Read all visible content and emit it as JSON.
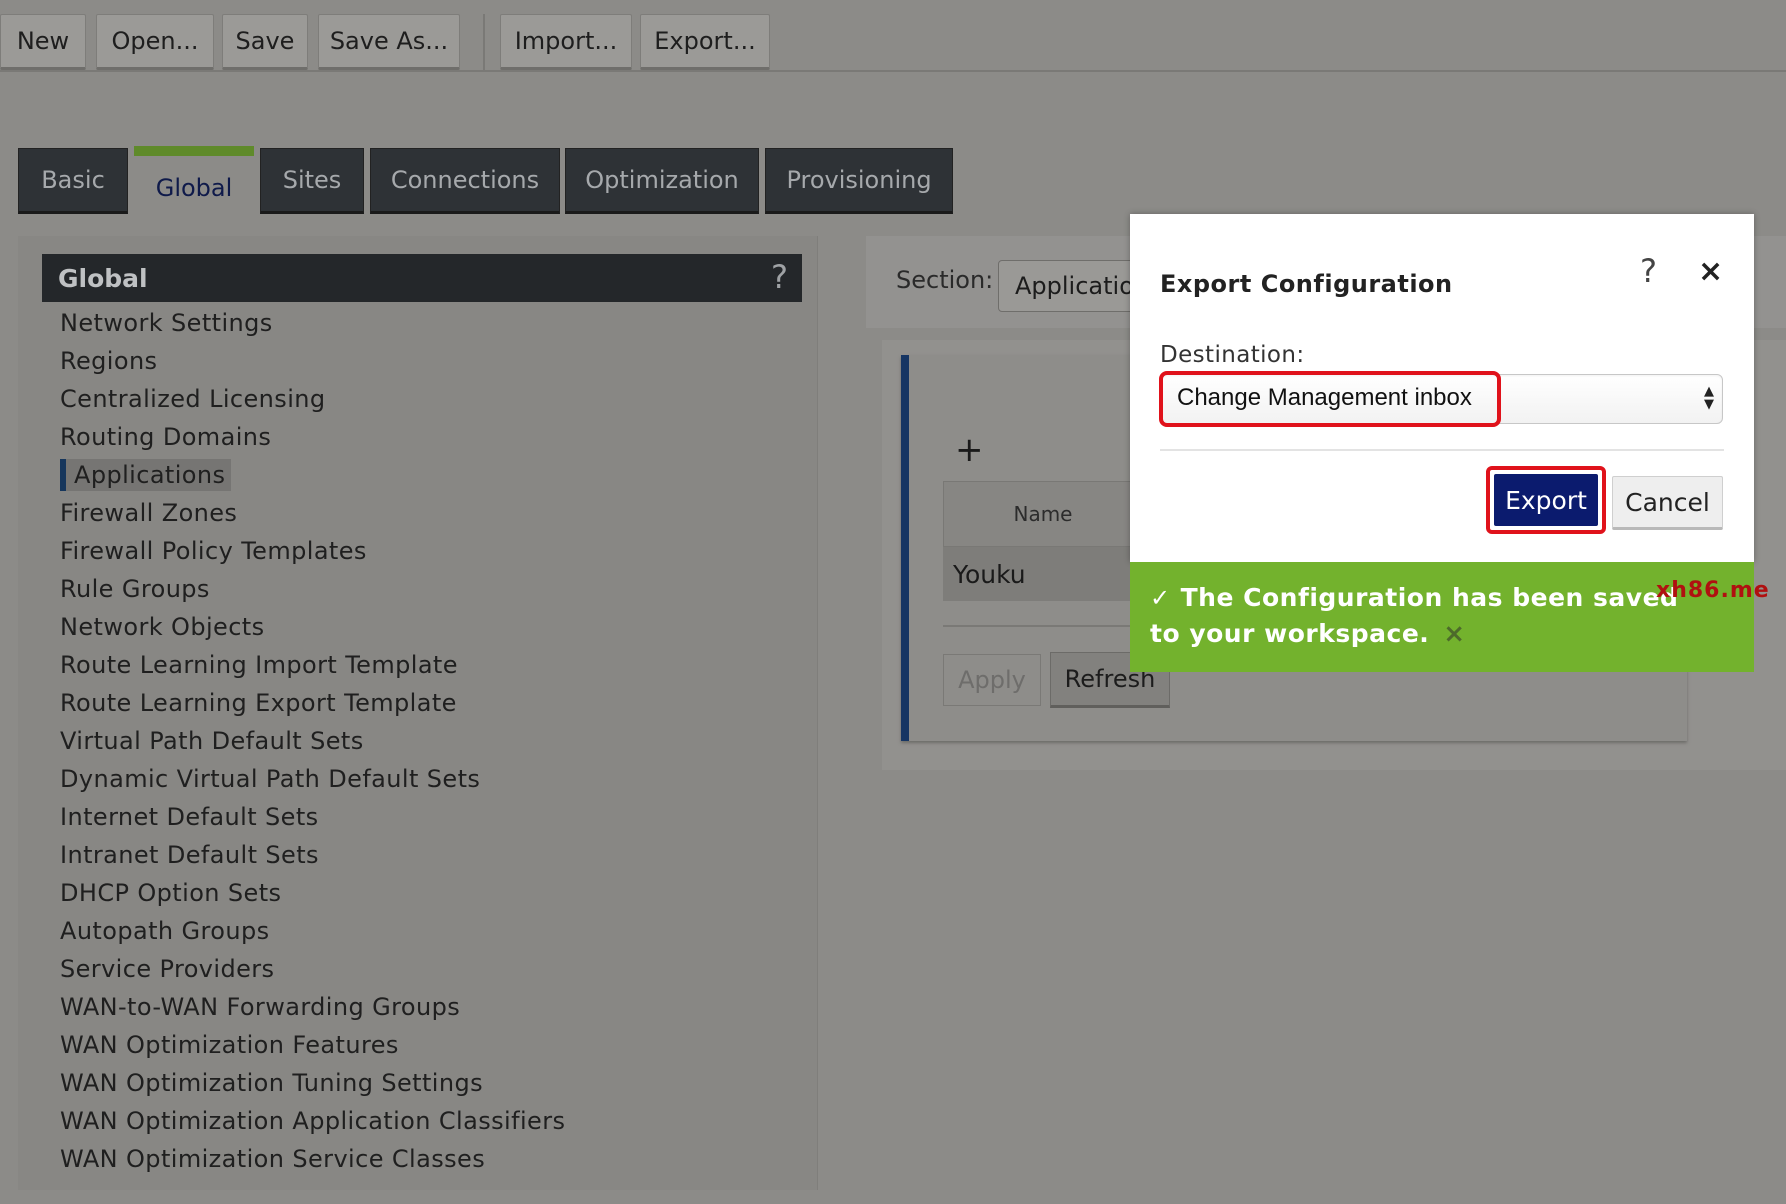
{
  "toolbar": {
    "buttons": [
      "New",
      "Open...",
      "Save",
      "Save As...",
      "Import...",
      "Export..."
    ]
  },
  "tabs": [
    {
      "label": "Basic",
      "active": false
    },
    {
      "label": "Global",
      "active": true
    },
    {
      "label": "Sites",
      "active": false
    },
    {
      "label": "Connections",
      "active": false
    },
    {
      "label": "Optimization",
      "active": false
    },
    {
      "label": "Provisioning",
      "active": false
    }
  ],
  "left_panel": {
    "title": "Global",
    "help": "?",
    "selected": "Applications",
    "items": [
      "Network Settings",
      "Regions",
      "Centralized Licensing",
      "Routing Domains",
      "Applications",
      "Firewall Zones",
      "Firewall Policy Templates",
      "Rule Groups",
      "Network Objects",
      "Route Learning Import Template",
      "Route Learning Export Template",
      "Virtual Path Default Sets",
      "Dynamic Virtual Path Default Sets",
      "Internet Default Sets",
      "Intranet Default Sets",
      "DHCP Option Sets",
      "Autopath Groups",
      "Service Providers",
      "WAN-to-WAN Forwarding Groups",
      "WAN Optimization Features",
      "WAN Optimization Tuning Settings",
      "WAN Optimization Application Classifiers",
      "WAN Optimization Service Classes"
    ]
  },
  "main": {
    "section_label": "Section:",
    "section_value": "Application",
    "add_symbol": "+",
    "table_header": "Name",
    "table_row": "Youku",
    "apply_label": "Apply",
    "refresh_label": "Refresh"
  },
  "modal": {
    "title": "Export Configuration",
    "help": "?",
    "close": "×",
    "destination_label": "Destination:",
    "destination_value": "Change Management inbox",
    "export_label": "Export",
    "cancel_label": "Cancel"
  },
  "toast": {
    "message": "The Configuration has been saved to your workspace.",
    "check": "✓",
    "close": "×"
  },
  "watermark": "xh86.me",
  "colors": {
    "toast_green": "#73b22d",
    "export_button": "#0b1b6e",
    "highlight_red": "#e0121b",
    "active_tab_bar": "#5f8a2a"
  }
}
